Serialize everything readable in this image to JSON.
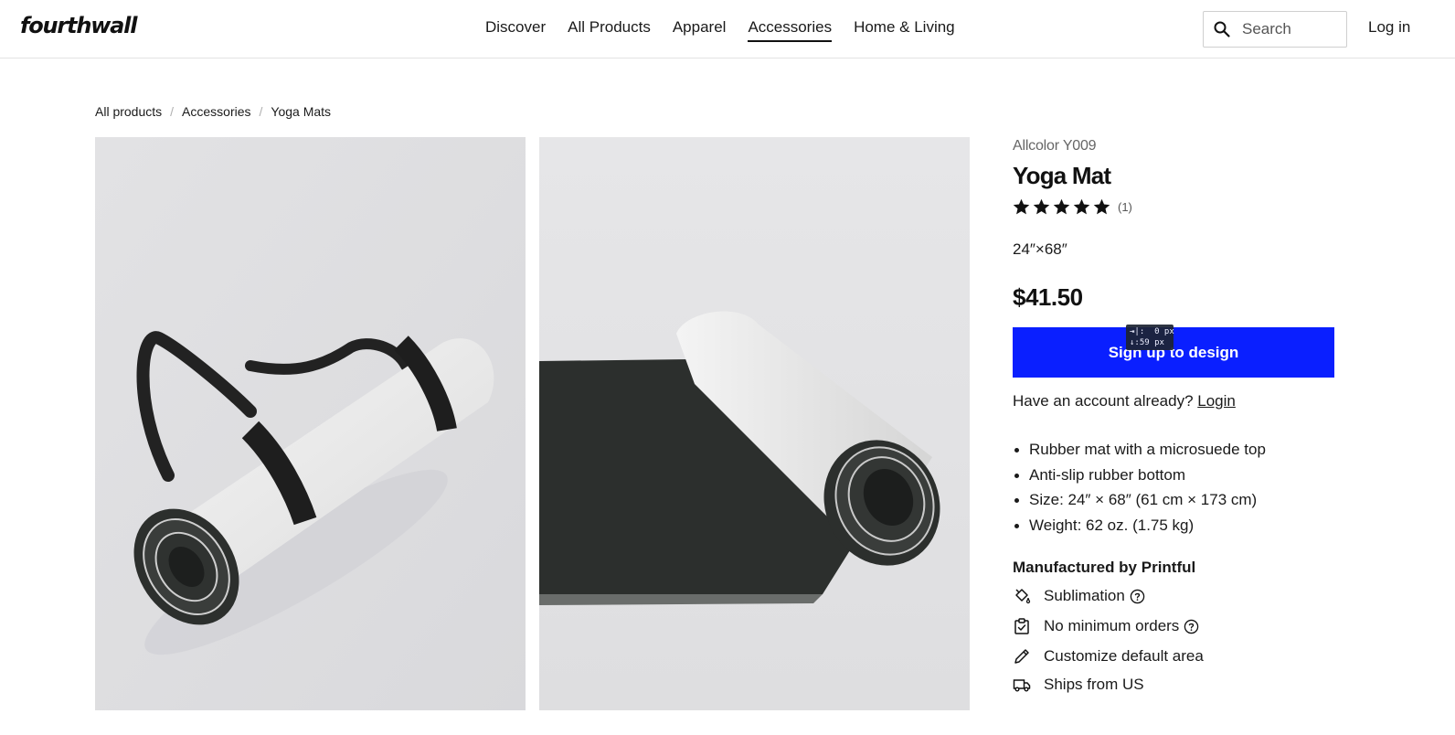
{
  "header": {
    "logo": "fourthwall",
    "nav": [
      "Discover",
      "All Products",
      "Apparel",
      "Accessories",
      "Home & Living"
    ],
    "active_nav": "Accessories",
    "search_placeholder": "Search",
    "login_label": "Log in"
  },
  "breadcrumb": [
    "All products",
    "Accessories",
    "Yoga Mats"
  ],
  "product": {
    "brand": "Allcolor Y009",
    "title": "Yoga Mat",
    "rating": 5,
    "review_count": "(1)",
    "size": "24″×68″",
    "price": "$41.50",
    "cta_label": "Sign up to design",
    "account_prompt": "Have an account already?",
    "account_link": "Login",
    "features": [
      "Rubber mat with a microsuede top",
      "Anti-slip rubber bottom",
      "Size: 24″ × 68″ (61 cm × 173 cm)",
      "Weight: 62 oz. (1.75 kg)"
    ],
    "manufacturer": "Manufactured by Printful",
    "attributes": [
      {
        "label": "Sublimation",
        "icon": "paint-bucket-icon",
        "help": true
      },
      {
        "label": "No minimum orders",
        "icon": "clipboard-check-icon",
        "help": true
      },
      {
        "label": "Customize default area",
        "icon": "pencil-icon",
        "help": false
      },
      {
        "label": "Ships from US",
        "icon": "truck-icon",
        "help": false
      }
    ]
  },
  "overlay": {
    "line1": "⇥|:  0 px",
    "line2": "↓:59 px"
  },
  "colors": {
    "cta": "#0a1fff",
    "image_bg": "#e4e4e6",
    "mat_dark": "#2c2f2d"
  }
}
